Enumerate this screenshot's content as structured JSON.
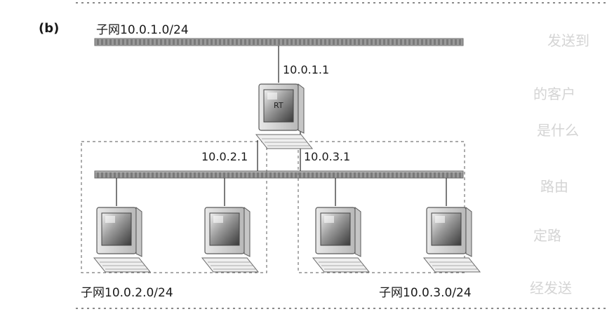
{
  "figure": {
    "panel_label": "(b)",
    "subnets": {
      "top": "子网10.0.1.0/24",
      "left": "子网10.0.2.0/24",
      "right": "子网10.0.3.0/24"
    },
    "router": {
      "label": "RT",
      "interfaces": {
        "top": "10.0.1.1",
        "left": "10.0.2.1",
        "right": "10.0.3.1"
      }
    },
    "hosts": [
      "host-1",
      "host-2",
      "host-3",
      "host-4"
    ]
  },
  "background_text": [
    "发送到",
    "的客户",
    "是什么",
    "路由",
    "定路",
    "经发送"
  ]
}
